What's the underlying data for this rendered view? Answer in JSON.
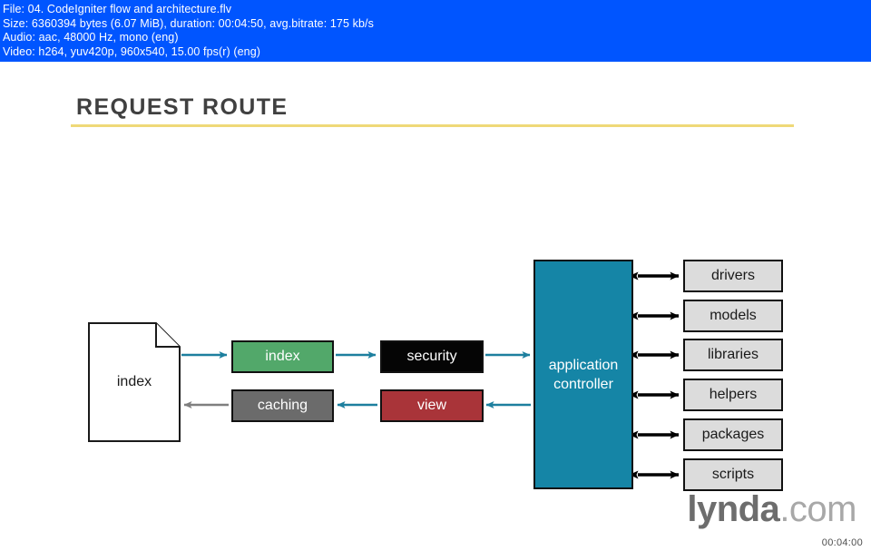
{
  "media_info": {
    "line_file": "File: 04. CodeIgniter flow and architecture.flv",
    "line_size": "Size: 6360394 bytes (6.07 MiB), duration: 00:04:50, avg.bitrate: 175 kb/s",
    "line_audio": "Audio: aac, 48000 Hz, mono (eng)",
    "line_video": "Video: h264, yuv420p, 960x540, 15.00 fps(r) (eng)",
    "background_color": "#0055ff",
    "text_color": "#ffffff"
  },
  "slide": {
    "title": "REQUEST ROUTE",
    "title_color": "#404040",
    "rule_color": "#efd978",
    "background_color": "#ffffff"
  },
  "diagram": {
    "document_node": {
      "label": "index",
      "fill": "#ffffff",
      "stroke": "#1a1a1a"
    },
    "pipeline_boxes": [
      {
        "id": "index",
        "label": "index",
        "fill": "#52a86a",
        "text_color": "#ffffff"
      },
      {
        "id": "caching",
        "label": "caching",
        "fill": "#6b6b6b",
        "text_color": "#ffffff"
      },
      {
        "id": "security",
        "label": "security",
        "fill": "#050505",
        "text_color": "#ffffff"
      },
      {
        "id": "view",
        "label": "view",
        "fill": "#a93439",
        "text_color": "#ffffff"
      }
    ],
    "controller": {
      "line1": "application",
      "line2": "controller",
      "fill": "#1585a6",
      "text_color": "#ffffff"
    },
    "resources": [
      {
        "label": "drivers"
      },
      {
        "label": "models"
      },
      {
        "label": "libraries"
      },
      {
        "label": "helpers"
      },
      {
        "label": "packages"
      },
      {
        "label": "scripts"
      }
    ],
    "arrow_colors": {
      "flow": "#1d7f9e",
      "return": "#7f7f7f",
      "bidirectional": "#000000"
    }
  },
  "branding": {
    "logo_word": "lynda",
    "logo_suffix": ".com",
    "timestamp": "00:04:00"
  }
}
